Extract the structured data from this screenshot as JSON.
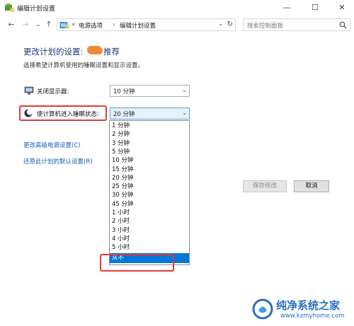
{
  "window": {
    "title": "编辑计划设置",
    "min_label": "—",
    "max_label": "☐",
    "close_label": "✕"
  },
  "nav": {
    "back_label": "←",
    "forward_label": "→",
    "dropdown_label": "⌄",
    "up_label": "↑",
    "breadcrumb_prefix": "«",
    "breadcrumb": [
      "电源选项",
      "编辑计划设置"
    ],
    "separator": "›",
    "refresh_label": "↻",
    "addr_dropdown_label": "⌄",
    "search_placeholder": "搜索控制面板"
  },
  "main": {
    "title": "更改计划的设置:",
    "title_suffix": "推荐",
    "description": "选择希望计算机使用的睡眠设置和显示设置。",
    "display_off": {
      "label": "关闭显示器:",
      "value": "10 分钟"
    },
    "sleep": {
      "label": "使计算机进入睡眠状态:",
      "value": "20 分钟"
    },
    "links": {
      "advanced": "更改高级电源设置(C)",
      "restore": "还原此计划的默认设置(R)"
    },
    "buttons": {
      "save": "保存修改",
      "cancel": "取消"
    }
  },
  "dropdown": {
    "options": [
      "1 分钟",
      "2 分钟",
      "3 分钟",
      "5 分钟",
      "10 分钟",
      "15 分钟",
      "20 分钟",
      "25 分钟",
      "30 分钟",
      "45 分钟",
      "1 小时",
      "2 小时",
      "3 小时",
      "4 小时",
      "5 小时",
      "从不"
    ],
    "selected": "从不"
  },
  "watermark": {
    "text": "纯净系统之家",
    "url": "www.kzmyhome.com"
  },
  "colors": {
    "selection": "#0078d7",
    "highlight_box": "#e23a3a",
    "link": "#1660b0",
    "heading": "#1e3c78"
  }
}
